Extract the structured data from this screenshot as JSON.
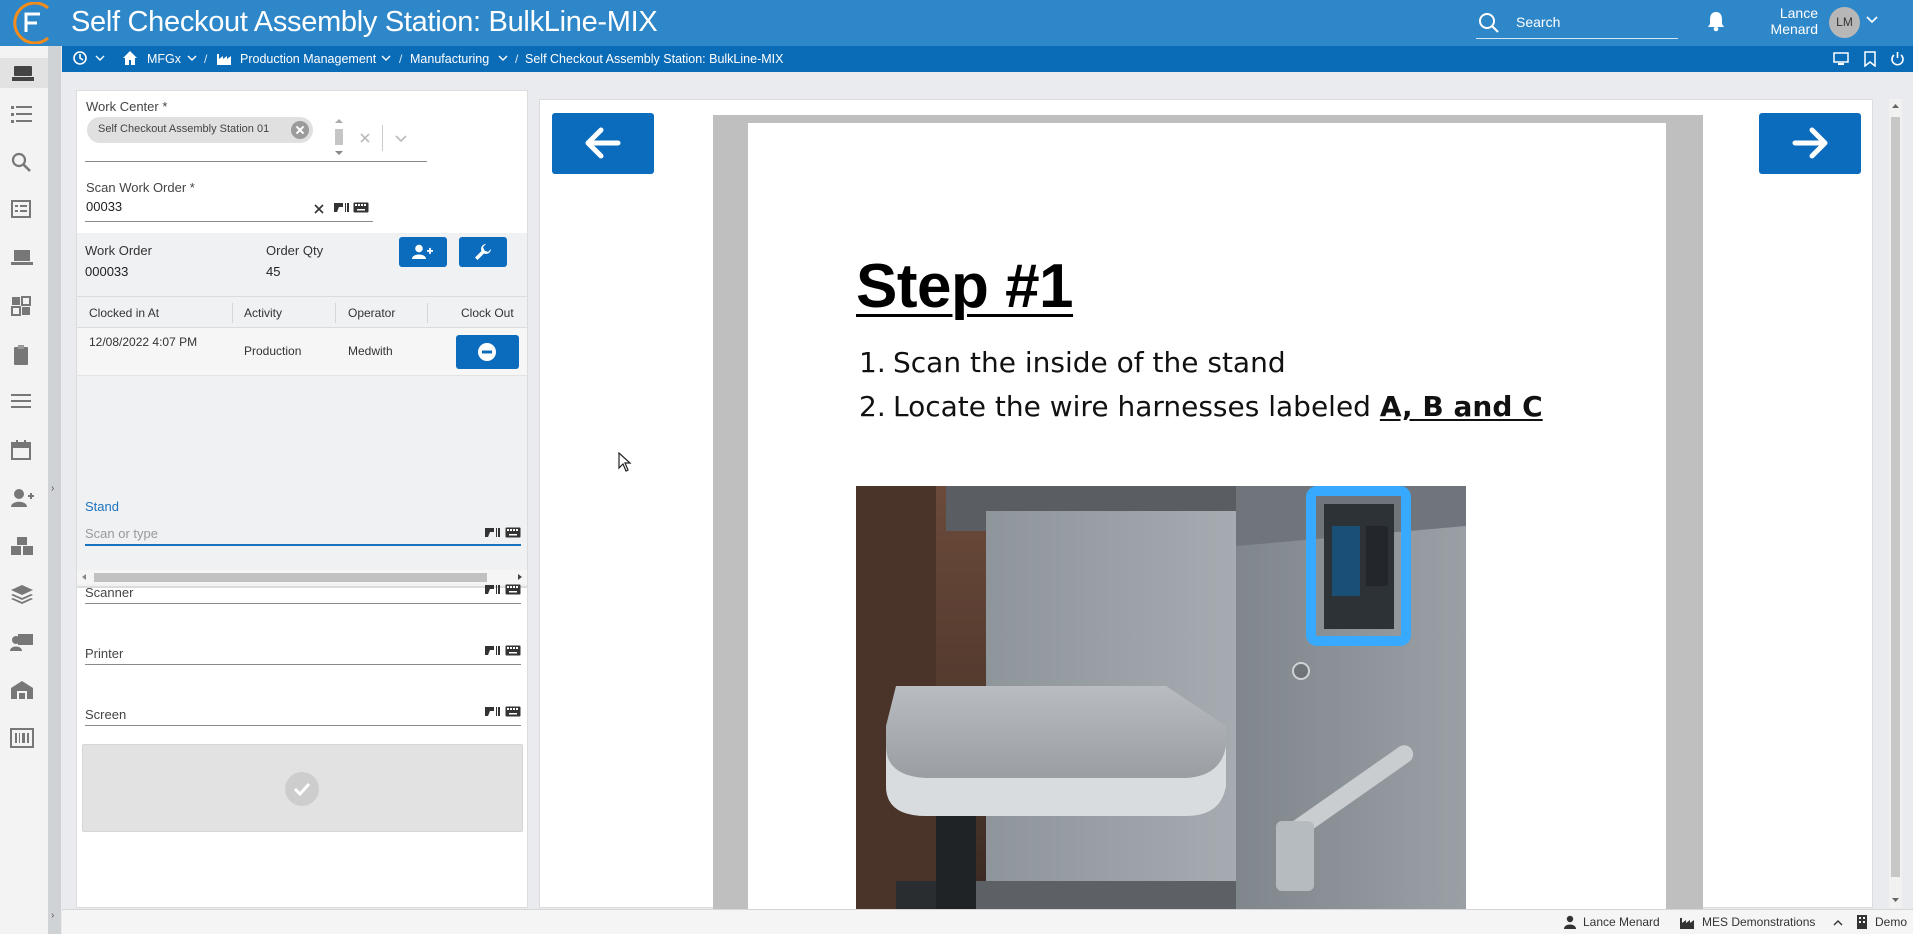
{
  "header": {
    "title": "Self Checkout Assembly Station: BulkLine-MIX",
    "search_label": "Search",
    "user_first": "Lance",
    "user_last": "Menard",
    "avatar_initials": "LM",
    "brand_color": "#2e87c9",
    "logo_accent": "#f28c1b"
  },
  "breadcrumb": {
    "items": [
      "MFGx",
      "Production Management",
      "Manufacturing",
      "Self Checkout Assembly Station: BulkLine-MIX"
    ]
  },
  "sidebar": {
    "icons": [
      "kiosk-icon",
      "list-icon",
      "search-icon",
      "checklist-icon",
      "laptop-icon",
      "dashboard-icon",
      "clipboard-icon",
      "menu-lines-icon",
      "calendar-icon",
      "add-user-icon",
      "boxes-icon",
      "layers-icon",
      "operator-console-icon",
      "warehouse-icon",
      "barcode-icon"
    ]
  },
  "form": {
    "work_center_label": "Work Center *",
    "work_center_value": "Self Checkout Assembly Station 01",
    "scan_work_order_label": "Scan Work Order *",
    "scan_work_order_value": "00033",
    "work_order_label": "Work Order",
    "work_order_value": "000033",
    "order_qty_label": "Order Qty",
    "order_qty_value": "45"
  },
  "clock_table": {
    "columns": [
      "Clocked in At",
      "Activity",
      "Operator",
      "Clock Out"
    ],
    "rows": [
      {
        "clocked_in_at": "12/08/2022 4:07 PM",
        "activity": "Production",
        "operator": "Medwith"
      }
    ]
  },
  "scan_fields": {
    "stand_label": "Stand",
    "stand_placeholder": "Scan or type",
    "scanner_label": "Scanner",
    "printer_label": "Printer",
    "screen_label": "Screen"
  },
  "document": {
    "step_title": "Step #1",
    "steps": [
      {
        "num": "1.",
        "text": "Scan the inside of the stand",
        "emphasis": ""
      },
      {
        "num": "2.",
        "text": "Locate the wire harnesses labeled ",
        "emphasis": "A, B and C"
      }
    ]
  },
  "statusbar": {
    "user": "Lance Menard",
    "site": "MES Demonstrations",
    "env": "Demo"
  }
}
